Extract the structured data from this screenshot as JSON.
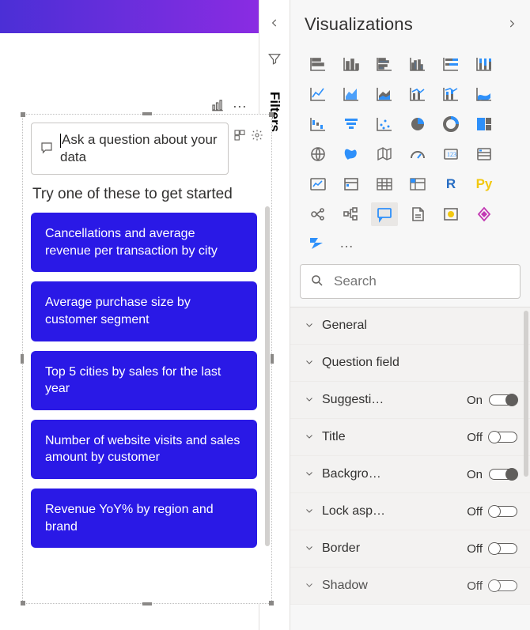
{
  "filters": {
    "label": "Filters"
  },
  "viz": {
    "title": "Visualizations",
    "search_placeholder": "Search",
    "icons": [
      "stacked-bar-chart-icon",
      "stacked-column-chart-icon",
      "clustered-bar-chart-icon",
      "clustered-column-chart-icon",
      "100pct-stacked-bar-chart-icon",
      "100pct-stacked-column-chart-icon",
      "line-chart-icon",
      "area-chart-icon",
      "stacked-area-chart-icon",
      "line-clustered-column-chart-icon",
      "line-stacked-column-chart-icon",
      "ribbon-chart-icon",
      "waterfall-chart-icon",
      "funnel-chart-icon",
      "scatter-chart-icon",
      "pie-chart-icon",
      "donut-chart-icon",
      "treemap-icon",
      "map-icon",
      "filled-map-icon",
      "shape-map-icon",
      "gauge-icon",
      "card-icon",
      "multi-row-card-icon",
      "kpi-icon",
      "slicer-icon",
      "table-icon",
      "matrix-icon",
      "r-visual-icon",
      "python-visual-icon",
      "key-influencers-icon",
      "decomposition-tree-icon",
      "qna-visual-icon",
      "paginated-report-icon",
      "arcgis-icon",
      "power-apps-icon"
    ],
    "extras": {
      "powerautomate": "power-automate-icon",
      "more": "…"
    }
  },
  "format": {
    "rows": [
      {
        "label": "General",
        "toggle": null
      },
      {
        "label": "Question field",
        "toggle": null
      },
      {
        "label": "Suggesti…",
        "toggle": "On"
      },
      {
        "label": "Title",
        "toggle": "Off"
      },
      {
        "label": "Backgro…",
        "toggle": "On"
      },
      {
        "label": "Lock asp…",
        "toggle": "Off"
      },
      {
        "label": "Border",
        "toggle": "Off"
      },
      {
        "label": "Shadow",
        "toggle": "Off"
      }
    ]
  },
  "qna": {
    "placeholder": "Ask a question about your data",
    "prompt": "Try one of these to get started",
    "suggestions": [
      "Cancellations and average revenue per transaction by city",
      "Average purchase size by customer segment",
      "Top 5 cities by sales for the last year",
      "Number of website visits and sales amount by customer",
      "Revenue YoY% by region and brand"
    ]
  }
}
